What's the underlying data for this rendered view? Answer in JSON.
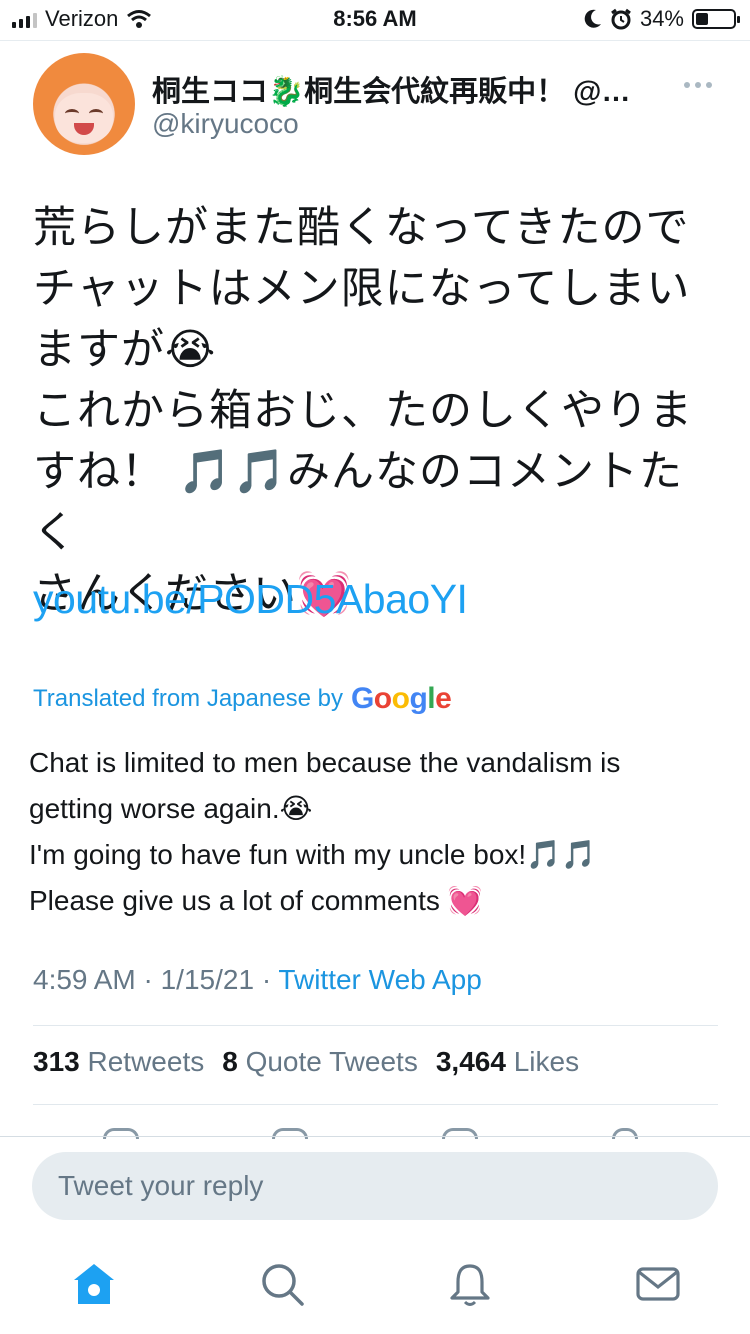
{
  "status_bar": {
    "carrier": "Verizon",
    "time": "8:56 AM",
    "battery_percent": "34%",
    "battery_level": 0.34
  },
  "tweet": {
    "author_name": "桐生ココ🐉桐生会代紋再販中！ @…",
    "author_handle": "@kiryucoco",
    "text_lines": [
      "荒らしがまた酷くなってきたので",
      "チャットはメン限になってしまい",
      "ますが😭",
      "これから箱おじ、たのしくやりま",
      "すね！ 🎵🎵みんなのコメントたく",
      "さんください💓"
    ],
    "link": "youtu.be/PODD5AbaoYI",
    "translated_label": "Translated from Japanese by",
    "google_label": "Google",
    "translation_lines": [
      "Chat is limited to men because the vandalism is",
      "getting worse again.😭",
      " I'm going to have fun with my uncle box!🎵🎵",
      "Please give us a lot of comments 💓"
    ],
    "timestamp": "4:59 AM · 1/15/21 · ",
    "source": "Twitter Web App",
    "stats": {
      "retweets_count": "313",
      "retweets_label": "Retweets",
      "quote_count": "8",
      "quote_label": "Quote Tweets",
      "likes_count": "3,464",
      "likes_label": "Likes"
    }
  },
  "reply": {
    "placeholder": "Tweet your reply"
  },
  "tabbar": {
    "items": [
      "home-icon",
      "search-icon",
      "notifications-icon",
      "messages-icon"
    ],
    "active_color": "#1da1f2",
    "inactive_color": "#657786"
  }
}
